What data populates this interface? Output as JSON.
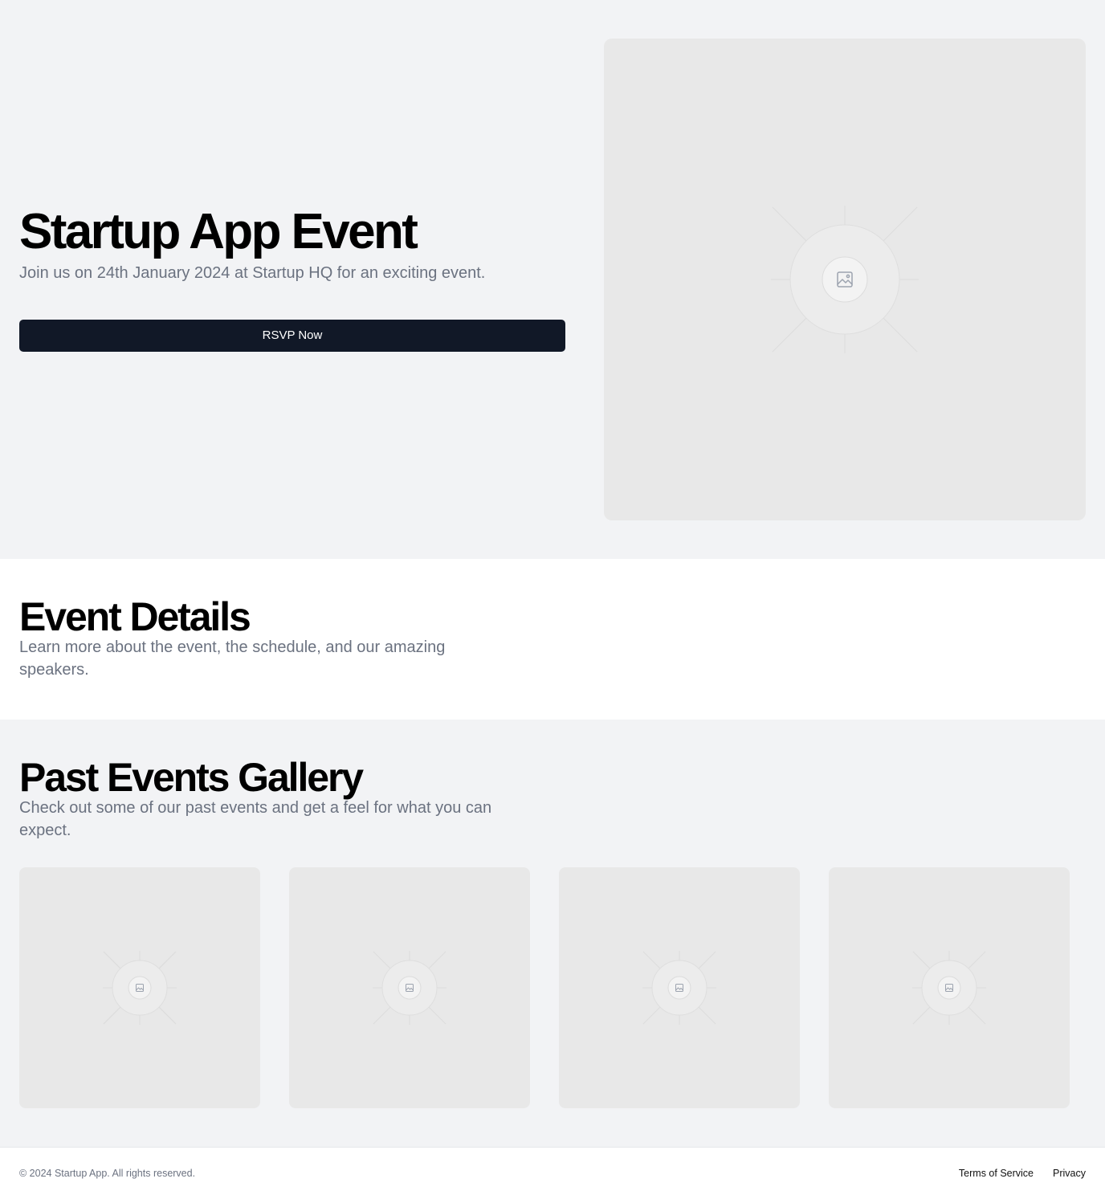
{
  "hero": {
    "title": "Startup App Event",
    "subtitle": "Join us on 24th January 2024 at Startup HQ for an exciting event.",
    "cta_label": "RSVP Now",
    "image_icon": "image-placeholder-icon"
  },
  "details": {
    "title": "Event Details",
    "subtitle": "Learn more about the event, the schedule, and our amazing speakers."
  },
  "gallery": {
    "title": "Past Events Gallery",
    "subtitle": "Check out some of our past events and get a feel for what you can expect.",
    "images": [
      {
        "icon": "image-placeholder-icon"
      },
      {
        "icon": "image-placeholder-icon"
      },
      {
        "icon": "image-placeholder-icon"
      },
      {
        "icon": "image-placeholder-icon"
      }
    ]
  },
  "footer": {
    "copyright": "© 2024 Startup App. All rights reserved.",
    "links": [
      {
        "label": "Terms of Service"
      },
      {
        "label": "Privacy"
      }
    ]
  },
  "colors": {
    "page_bg_alt": "#f2f3f5",
    "placeholder_bg": "#e8e8e8",
    "button_bg": "#111827",
    "button_text": "#ffffff",
    "muted_text": "#6b7280"
  }
}
